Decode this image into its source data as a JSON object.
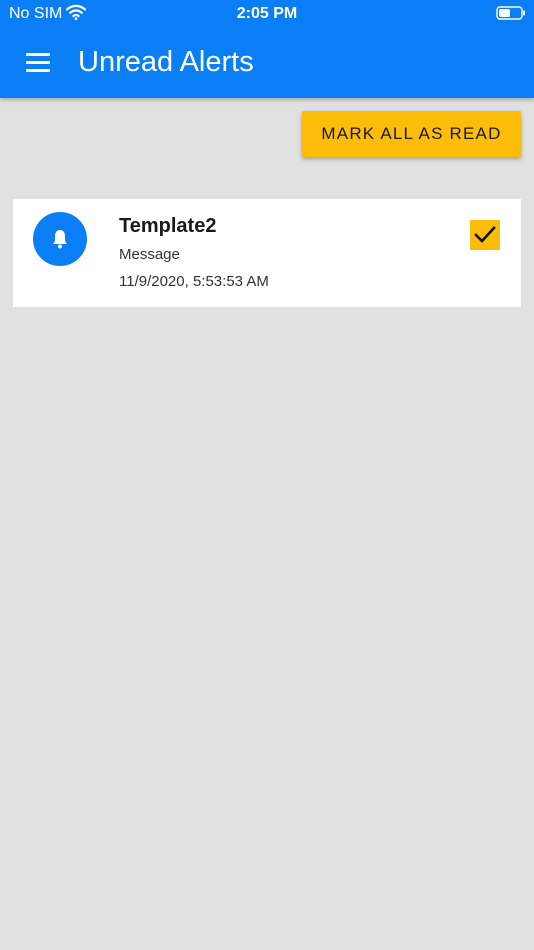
{
  "status_bar": {
    "carrier": "No SIM",
    "time": "2:05 PM",
    "icons": [
      "wifi-icon",
      "battery-icon"
    ]
  },
  "header": {
    "title": "Unread Alerts",
    "menu_icon": "hamburger-menu-icon",
    "color": "#0a7ff5"
  },
  "actions": {
    "mark_all_label": "MARK ALL AS READ",
    "mark_all_color": "#fbbd0a"
  },
  "alerts": [
    {
      "icon": "bell-icon",
      "title": "Template2",
      "message": "Message",
      "timestamp": "11/9/2020, 5:53:53 AM",
      "checked": true
    }
  ],
  "colors": {
    "background": "#e1e1e1",
    "accent": "#0a7ff5",
    "highlight": "#fbbd0a"
  }
}
